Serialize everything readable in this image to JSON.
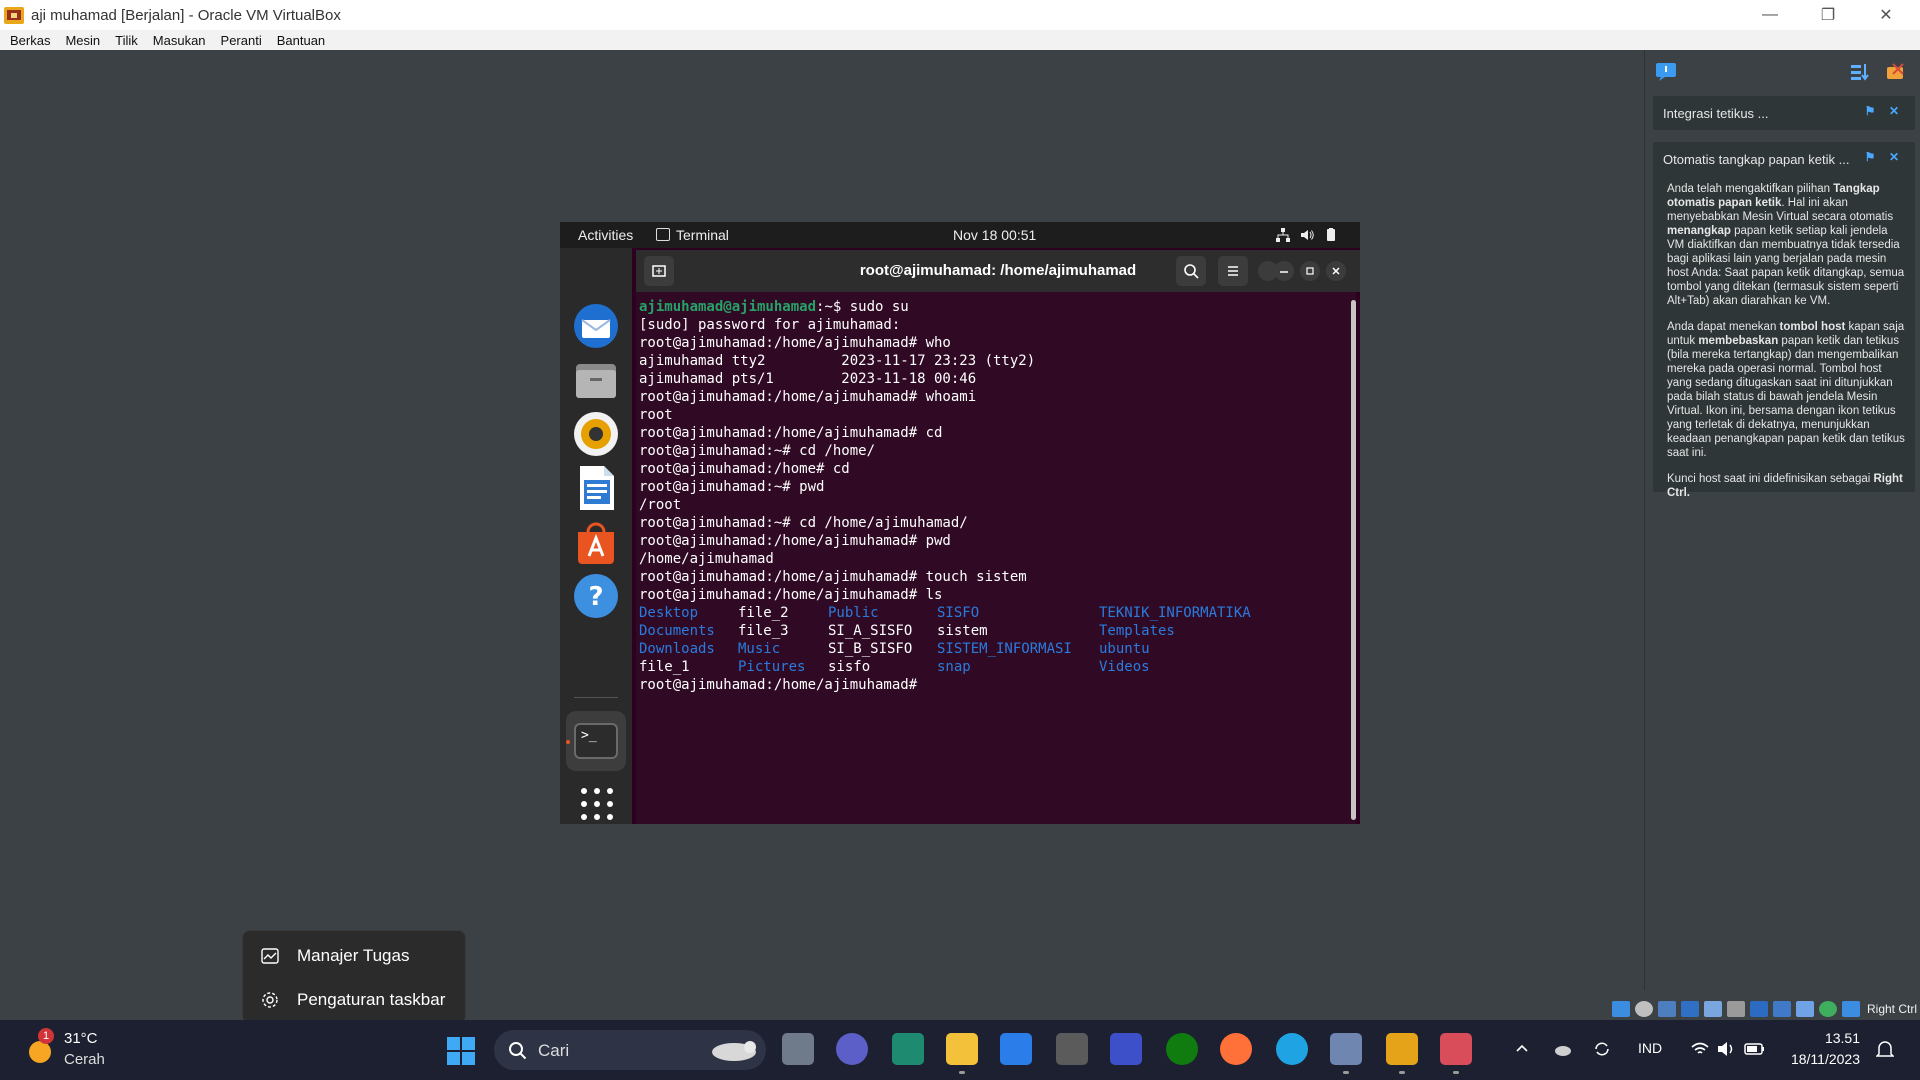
{
  "window": {
    "title": "aji muhamad  [Berjalan] - Oracle VM VirtualBox",
    "controls": {
      "minimize": "—",
      "maximize": "❐",
      "close": "✕"
    }
  },
  "menubar": [
    "Berkas",
    "Mesin",
    "Tilik",
    "Masukan",
    "Peranti",
    "Bantuan"
  ],
  "guest": {
    "topbar": {
      "activities": "Activities",
      "app": "Terminal",
      "clock": "Nov 18  00:51"
    },
    "terminal": {
      "title": "root@ajimuhamad: /home/ajimuhamad",
      "first_prompt_user": "ajimuhamad@ajimuhamad",
      "first_prompt_rest": ":~$ sudo su",
      "lines": [
        "[sudo] password for ajimuhamad:",
        "root@ajimuhamad:/home/ajimuhamad# who",
        "ajimuhamad tty2         2023-11-17 23:23 (tty2)",
        "ajimuhamad pts/1        2023-11-18 00:46",
        "root@ajimuhamad:/home/ajimuhamad# whoami",
        "root",
        "root@ajimuhamad:/home/ajimuhamad# cd",
        "root@ajimuhamad:~# cd /home/",
        "root@ajimuhamad:/home# cd",
        "root@ajimuhamad:~# pwd",
        "/root",
        "root@ajimuhamad:~# cd /home/ajimuhamad/",
        "root@ajimuhamad:/home/ajimuhamad# pwd",
        "/home/ajimuhamad",
        "root@ajimuhamad:/home/ajimuhamad# touch sistem",
        "root@ajimuhamad:/home/ajimuhamad# ls"
      ],
      "ls_rows": [
        [
          {
            "t": "Desktop",
            "c": "dir"
          },
          {
            "t": "file_2",
            "c": "file"
          },
          {
            "t": "Public",
            "c": "dir"
          },
          {
            "t": "SISFO",
            "c": "dir"
          },
          {
            "t": "TEKNIK_INFORMATIKA",
            "c": "dir"
          }
        ],
        [
          {
            "t": "Documents",
            "c": "dir"
          },
          {
            "t": "file_3",
            "c": "file"
          },
          {
            "t": "SI_A_SISFO",
            "c": "file"
          },
          {
            "t": "sistem",
            "c": "file"
          },
          {
            "t": "Templates",
            "c": "dir"
          }
        ],
        [
          {
            "t": "Downloads",
            "c": "dir"
          },
          {
            "t": "Music",
            "c": "dir"
          },
          {
            "t": "SI_B_SISFO",
            "c": "file"
          },
          {
            "t": "SISTEM_INFORMASI",
            "c": "dir"
          },
          {
            "t": "ubuntu",
            "c": "dir"
          }
        ],
        [
          {
            "t": "file_1",
            "c": "file"
          },
          {
            "t": "Pictures",
            "c": "dir"
          },
          {
            "t": "sisfo",
            "c": "file"
          },
          {
            "t": "snap",
            "c": "dir"
          },
          {
            "t": "Videos",
            "c": "dir"
          }
        ]
      ],
      "final_prompt": "root@ajimuhamad:/home/ajimuhamad# "
    }
  },
  "notifications": [
    {
      "title": "Integrasi tetikus ..."
    },
    {
      "title": "Otomatis tangkap papan ketik ...",
      "p1_a": "Anda telah mengaktifkan pilihan ",
      "p1_b": "Tangkap otomatis papan ketik",
      "p1_c": ". Hal ini akan menyebabkan Mesin Virtual secara otomatis ",
      "p1_d": "menangkap",
      "p1_e": " papan ketik setiap kali jendela VM diaktifkan dan membuatnya tidak tersedia bagi aplikasi lain yang berjalan pada mesin host Anda: Saat papan ketik ditangkap, semua tombol yang ditekan (termasuk sistem seperti Alt+Tab) akan diarahkan ke VM.",
      "p2_a": "Anda dapat menekan ",
      "p2_b": "tombol host",
      "p2_c": " kapan saja untuk ",
      "p2_d": "membebaskan",
      "p2_e": " papan ketik dan tetikus (bila mereka tertangkap) dan mengembalikan mereka pada operasi normal. Tombol host yang sedang ditugaskan saat ini ditunjukkan pada bilah status di bawah jendela Mesin Virtual. Ikon ini, bersama dengan ikon tetikus yang terletak di dekatnya, menunjukkan keadaan penangkapan papan ketik dan tetikus saat ini.",
      "p3_a": "Kunci host saat ini didefinisikan sebagai ",
      "p3_b": "Right Ctrl."
    }
  ],
  "vm_status": {
    "host_key": "Right Ctrl"
  },
  "context_menu": {
    "item1": "Manajer Tugas",
    "item2": "Pengaturan taskbar"
  },
  "taskbar": {
    "weather_badge": "1",
    "temp": "31°C",
    "condition": "Cerah",
    "search_placeholder": "Cari",
    "lang": "IND",
    "time": "13.51",
    "date": "18/11/2023"
  },
  "colors": {
    "accent_orange": "#e95420",
    "terminal_bg": "#300a24",
    "dir_blue": "#2a7bde",
    "prompt_green": "#26a269"
  }
}
